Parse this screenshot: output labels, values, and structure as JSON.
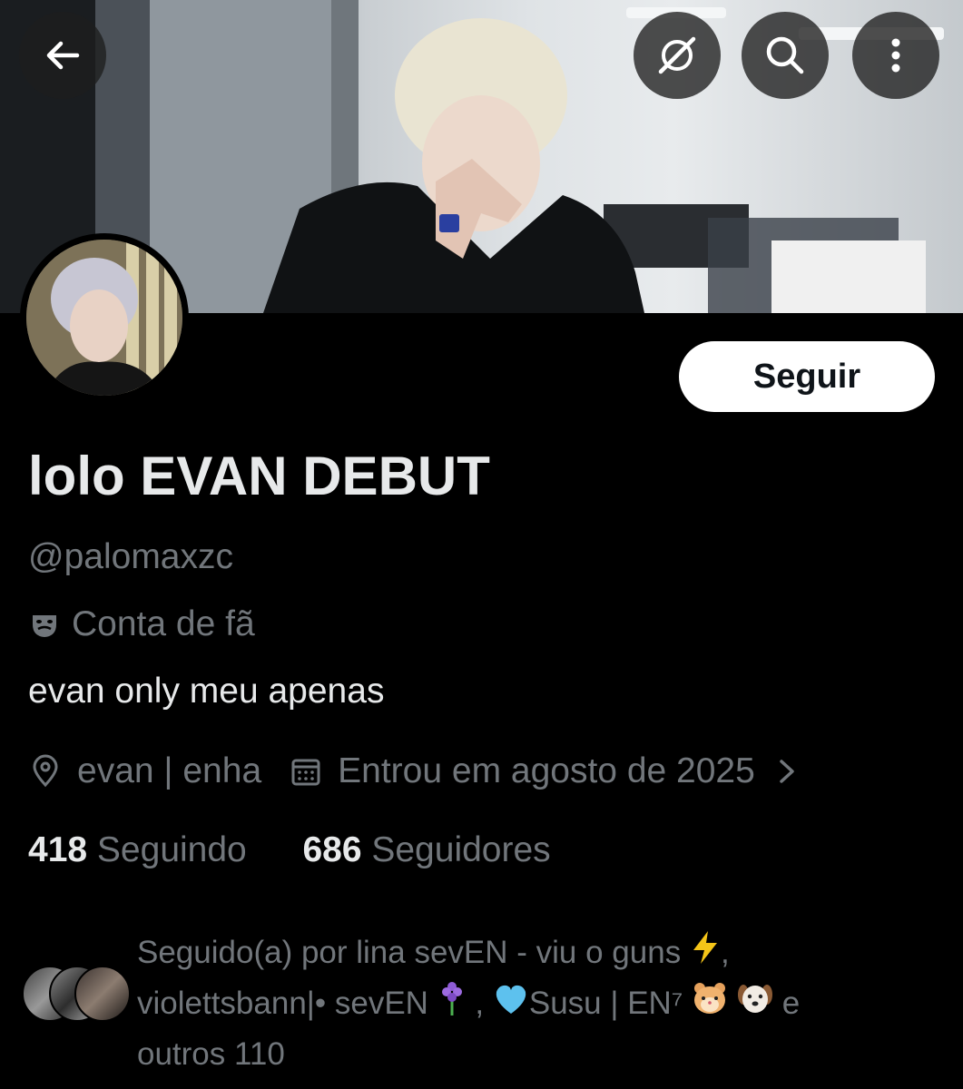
{
  "header": {
    "back_icon": "arrow-left-icon",
    "translate_icon": "grok-slash-icon",
    "search_icon": "search-icon",
    "more_icon": "more-vertical-icon"
  },
  "profile": {
    "follow_label": "Seguir",
    "display_name": "lolo EVAN DEBUT",
    "handle": "@palomaxzc",
    "fan_label": "Conta de fã",
    "bio": "evan only meu apenas",
    "location": "evan | enha",
    "joined": "Entrou em agosto de 2025",
    "following_count": "418",
    "following_label": "Seguindo",
    "followers_count": "686",
    "followers_label": "Seguidores"
  },
  "followed_by": {
    "prefix": "Seguido(a) por lina sevEN - viu o guns",
    "name2": "violettsbann|• sevEN",
    "name3": "Susu | EN⁷",
    "suffix": "e",
    "others": "outros 110"
  },
  "colors": {
    "background": "#000000",
    "primary_text": "#e7e9ea",
    "secondary_text": "#71767b",
    "button_bg": "#ffffff"
  }
}
